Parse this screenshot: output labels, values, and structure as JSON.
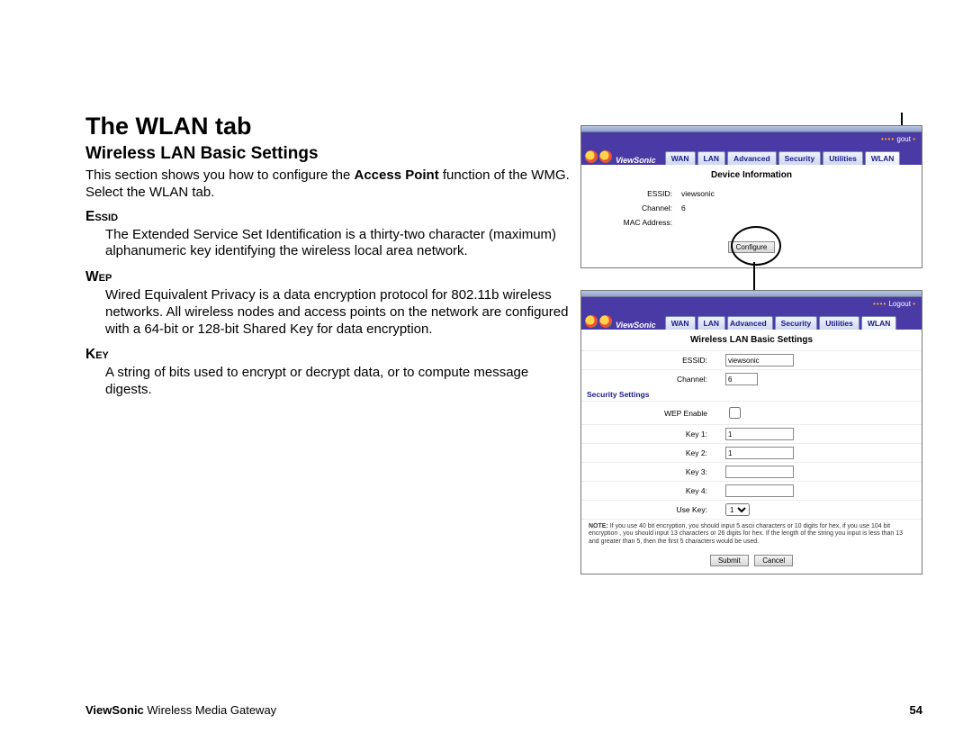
{
  "heading": "The WLAN tab",
  "subheading": "Wireless LAN Basic Settings",
  "intro_before": "This section shows you how to configure the ",
  "intro_bold": "Access Point",
  "intro_after": " function of the WMG. Select the WLAN tab.",
  "terms": {
    "essid": {
      "label": "Essid",
      "def": "The Extended Service Set Identification is a thirty-two character (maximum) alphanumeric key identifying the wireless local area network."
    },
    "wep": {
      "label": "Wep",
      "def": "Wired Equivalent Privacy is a data encryption protocol for 802.11b wireless networks.  All wireless nodes and access points on the network are configured with a 64-bit or 128-bit Shared Key for data encryption."
    },
    "key": {
      "label": "Key",
      "def": "A string of bits used to encrypt or decrypt data, or to compute message digests."
    }
  },
  "tabs": [
    "WAN",
    "LAN",
    "Advanced",
    "Security",
    "Utilities",
    "WLAN"
  ],
  "brand": "ViewSonic",
  "logout_full": "Logout",
  "logout_partial": "gout",
  "panel1": {
    "title": "Device Information",
    "rows": {
      "essid_label": "ESSID:",
      "essid_val": "viewsonic",
      "channel_label": "Channel:",
      "channel_val": "6",
      "mac_label": "MAC Address:",
      "mac_val": ""
    },
    "configure_btn": "Configure"
  },
  "panel2": {
    "title": "Wireless LAN Basic Settings",
    "essid_label": "ESSID:",
    "essid_val": "viewsonic",
    "channel_label": "Channel:",
    "channel_val": "6",
    "sec_heading": "Security Settings",
    "wep_enable": "WEP Enable",
    "key1": "Key 1:",
    "key1_val": "1",
    "key2": "Key 2:",
    "key2_val": "1",
    "key3": "Key 3:",
    "key3_val": "",
    "key4": "Key 4:",
    "key4_val": "",
    "usekey": "Use Key:",
    "usekey_val": "1",
    "note_label": "NOTE:",
    "note": "If you use 40 bit encryption, you should input 5 ascii characters or 10 digits for hex, if you use 104 bit encryption , you should input 13 characters or 26 digits for hex.   If the length of the string you input is less than 13 and greater than 5, then the first 5 characters would be used.",
    "submit": "Submit",
    "cancel": "Cancel"
  },
  "footer": {
    "brand": "ViewSonic",
    "product": " Wireless Media Gateway",
    "page": "54"
  }
}
